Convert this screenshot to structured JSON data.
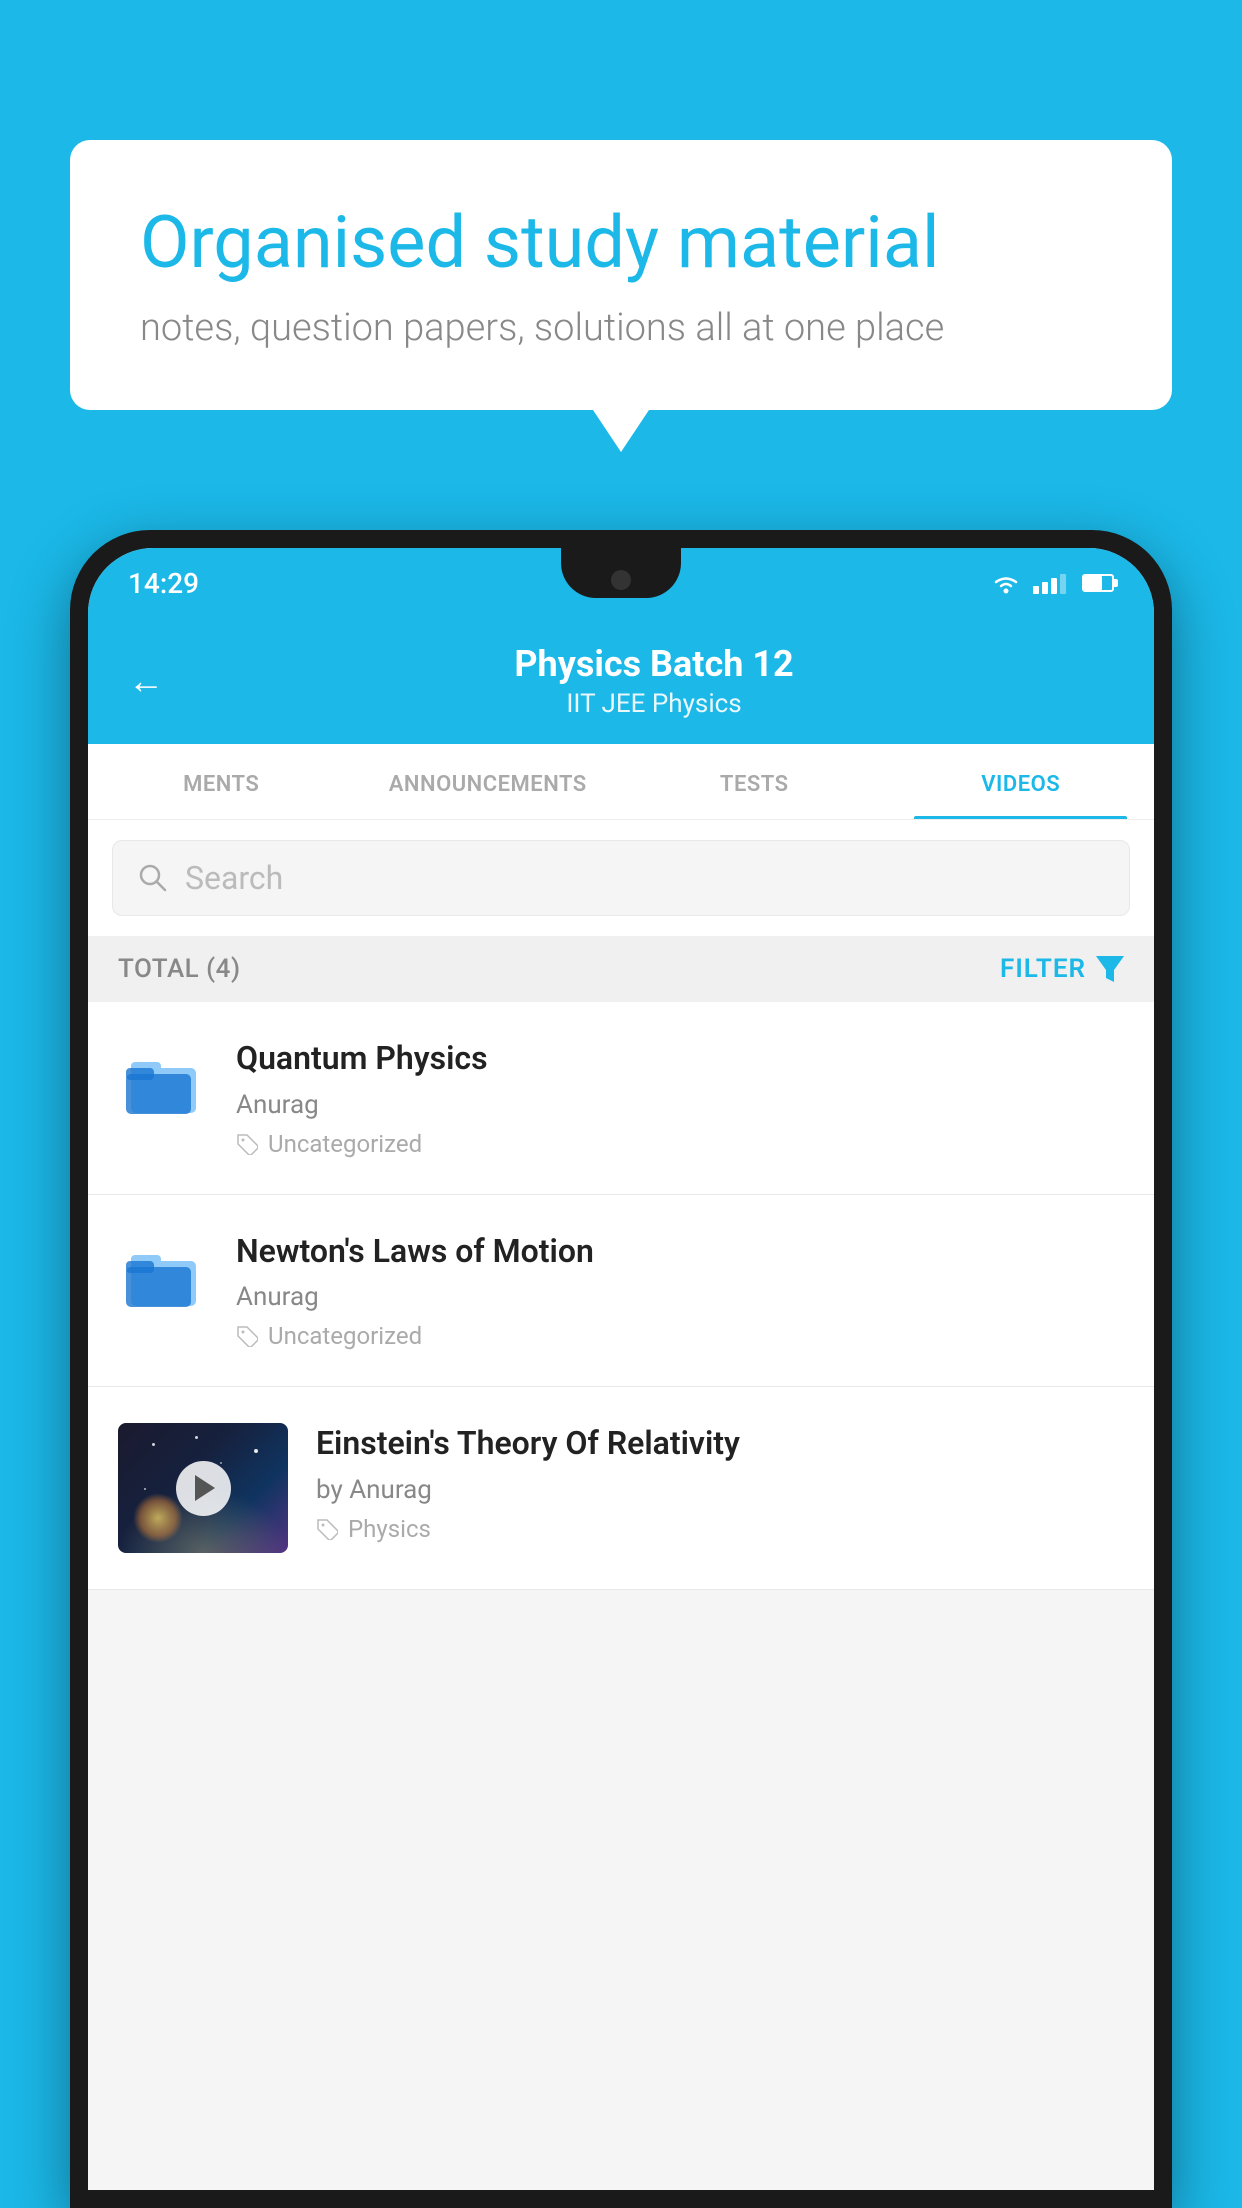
{
  "background_color": "#1BB8E8",
  "speech_bubble": {
    "heading": "Organised study material",
    "subtext": "notes, question papers, solutions all at one place"
  },
  "status_bar": {
    "time": "14:29"
  },
  "app_header": {
    "title": "Physics Batch 12",
    "subtitle": "IIT JEE    Physics",
    "back_label": "←"
  },
  "tabs": [
    {
      "label": "MENTS",
      "active": false
    },
    {
      "label": "ANNOUNCEMENTS",
      "active": false
    },
    {
      "label": "TESTS",
      "active": false
    },
    {
      "label": "VIDEOS",
      "active": true
    }
  ],
  "search": {
    "placeholder": "Search"
  },
  "filter_bar": {
    "total_label": "TOTAL (4)",
    "filter_label": "FILTER"
  },
  "videos": [
    {
      "title": "Quantum Physics",
      "author": "Anurag",
      "tag": "Uncategorized",
      "type": "folder",
      "has_thumbnail": false
    },
    {
      "title": "Newton's Laws of Motion",
      "author": "Anurag",
      "tag": "Uncategorized",
      "type": "folder",
      "has_thumbnail": false
    },
    {
      "title": "Einstein's Theory Of Relativity",
      "author": "by Anurag",
      "tag": "Physics",
      "type": "video",
      "has_thumbnail": true
    }
  ]
}
